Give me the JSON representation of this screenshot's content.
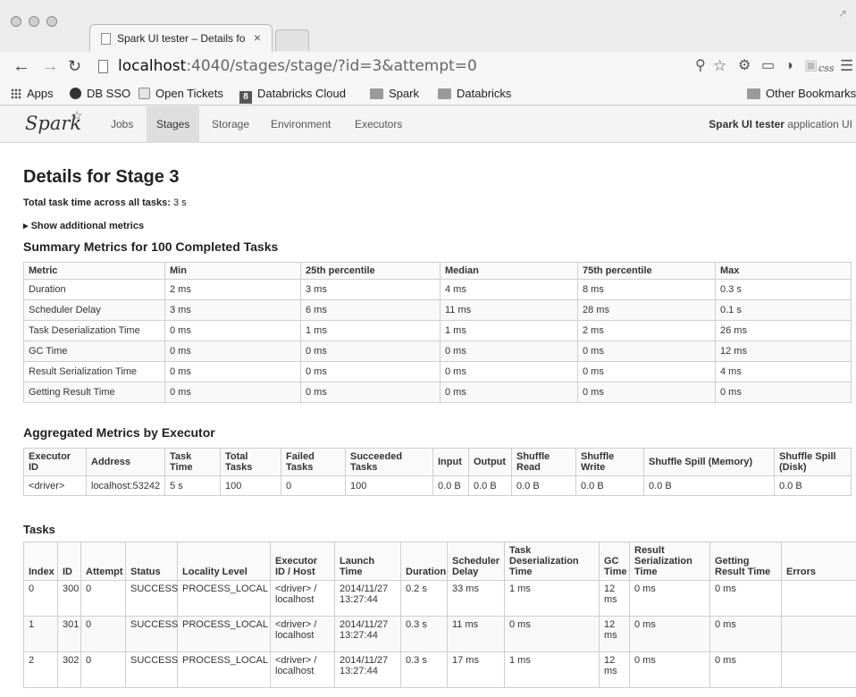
{
  "browser": {
    "tab_title": "Spark UI tester – Details fo",
    "tab_close": "×",
    "url_host": "localhost",
    "url_rest": ":4040/stages/stage/?id=3&attempt=0",
    "css_label": "css"
  },
  "bookmarks": [
    {
      "label": "Apps",
      "icon": "apps-grid-icon"
    },
    {
      "label": "DB SSO",
      "icon": "db-sso-icon"
    },
    {
      "label": "Open Tickets",
      "icon": "open-tickets-icon"
    },
    {
      "label": "Databricks Cloud",
      "icon": "databricks-icon"
    },
    {
      "label": "Spark",
      "icon": "folder-icon"
    },
    {
      "label": "Databricks",
      "icon": "folder-icon"
    }
  ],
  "other_bookmarks": "Other Bookmarks",
  "spark_nav": {
    "logo": "Spark",
    "items": [
      "Jobs",
      "Stages",
      "Storage",
      "Environment",
      "Executors"
    ],
    "active": "Stages",
    "app_name": "Spark UI tester",
    "app_suffix": " application UI"
  },
  "page": {
    "title": "Details for Stage 3",
    "total_time_label": "Total task time across all tasks:",
    "total_time_value": "3 s",
    "show_metrics": "▸ Show additional metrics"
  },
  "summary": {
    "title": "Summary Metrics for 100 Completed Tasks",
    "columns": [
      "Metric",
      "Min",
      "25th percentile",
      "Median",
      "75th percentile",
      "Max"
    ],
    "rows": [
      [
        "Duration",
        "2 ms",
        "3 ms",
        "4 ms",
        "8 ms",
        "0.3 s"
      ],
      [
        "Scheduler Delay",
        "3 ms",
        "6 ms",
        "11 ms",
        "28 ms",
        "0.1 s"
      ],
      [
        "Task Deserialization Time",
        "0 ms",
        "1 ms",
        "1 ms",
        "2 ms",
        "26 ms"
      ],
      [
        "GC Time",
        "0 ms",
        "0 ms",
        "0 ms",
        "0 ms",
        "12 ms"
      ],
      [
        "Result Serialization Time",
        "0 ms",
        "0 ms",
        "0 ms",
        "0 ms",
        "4 ms"
      ],
      [
        "Getting Result Time",
        "0 ms",
        "0 ms",
        "0 ms",
        "0 ms",
        "0 ms"
      ]
    ]
  },
  "aggregated": {
    "title": "Aggregated Metrics by Executor",
    "columns": [
      "Executor ID",
      "Address",
      "Task Time",
      "Total Tasks",
      "Failed Tasks",
      "Succeeded Tasks",
      "Input",
      "Output",
      "Shuffle Read",
      "Shuffle Write",
      "Shuffle Spill (Memory)",
      "Shuffle Spill (Disk)"
    ],
    "rows": [
      [
        "<driver>",
        "localhost:53242",
        "5 s",
        "100",
        "0",
        "100",
        "0.0 B",
        "0.0 B",
        "0.0 B",
        "0.0 B",
        "0.0 B",
        "0.0 B"
      ]
    ]
  },
  "tasks": {
    "title": "Tasks",
    "columns": [
      "Index",
      "ID",
      "Attempt",
      "Status",
      "Locality Level",
      "Executor ID / Host",
      "Launch Time",
      "Duration",
      "Scheduler Delay",
      "Task Deserialization Time",
      "GC Time",
      "Result Serialization Time",
      "Getting Result Time",
      "Errors"
    ],
    "rows": [
      [
        "0",
        "300",
        "0",
        "SUCCESS",
        "PROCESS_LOCAL",
        "<driver> / localhost",
        "2014/11/27 13:27:44",
        "0.2 s",
        "33 ms",
        "1 ms",
        "12 ms",
        "0 ms",
        "0 ms",
        ""
      ],
      [
        "1",
        "301",
        "0",
        "SUCCESS",
        "PROCESS_LOCAL",
        "<driver> / localhost",
        "2014/11/27 13:27:44",
        "0.3 s",
        "11 ms",
        "0 ms",
        "12 ms",
        "0 ms",
        "0 ms",
        ""
      ],
      [
        "2",
        "302",
        "0",
        "SUCCESS",
        "PROCESS_LOCAL",
        "<driver> / localhost",
        "2014/11/27 13:27:44",
        "0.3 s",
        "17 ms",
        "1 ms",
        "12 ms",
        "0 ms",
        "0 ms",
        ""
      ]
    ]
  }
}
